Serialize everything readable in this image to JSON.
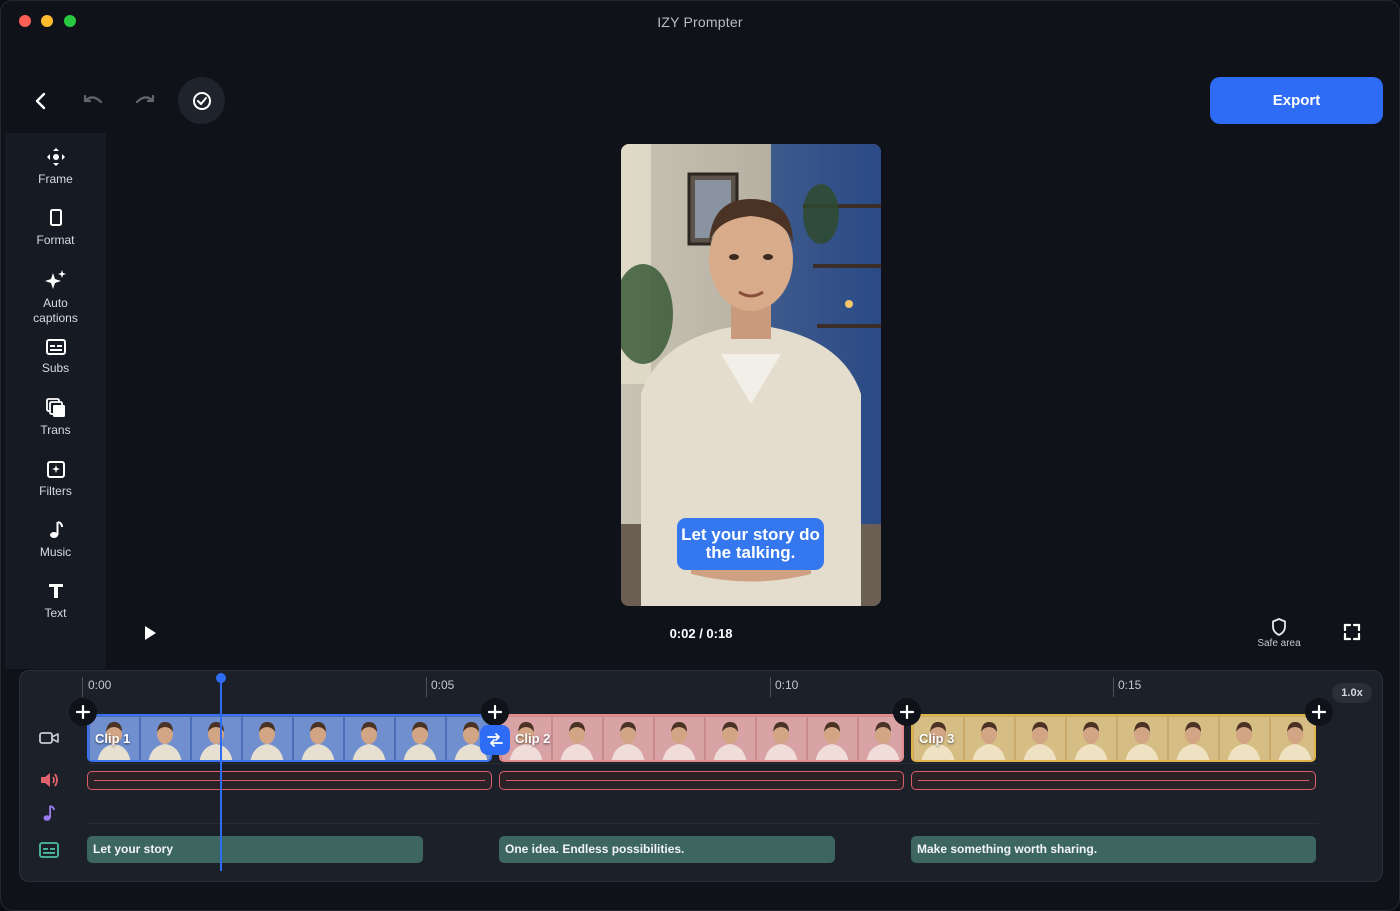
{
  "app": {
    "title": "IZY Prompter"
  },
  "toolbar": {
    "export_label": "Export"
  },
  "sidebar": {
    "items": [
      {
        "label": "Frame",
        "icon": "move-icon"
      },
      {
        "label": "Format",
        "icon": "rectangle-icon"
      },
      {
        "label": "Auto captions",
        "icon": "sparkles-icon"
      },
      {
        "label": "Subs",
        "icon": "subtitles-icon"
      },
      {
        "label": "Trans",
        "icon": "layers-icon"
      },
      {
        "label": "Filters",
        "icon": "filter-icon"
      },
      {
        "label": "Music",
        "icon": "music-note-icon"
      },
      {
        "label": "Text",
        "icon": "text-icon"
      }
    ]
  },
  "preview": {
    "caption": "Let your story do the talking.",
    "time": "0:02 / 0:18",
    "safe_area_label": "Safe area"
  },
  "timeline": {
    "ruler": [
      "0:00",
      "0:05",
      "0:10",
      "0:15"
    ],
    "speed": "1.0x",
    "clips": [
      {
        "label": "Clip 1",
        "color": "#3a72f0"
      },
      {
        "label": "Clip 2",
        "color": "#e58a8f"
      },
      {
        "label": "Clip 3",
        "color": "#e0b24a"
      }
    ],
    "subtitles": [
      "Let your story",
      "One idea. Endless possibilities.",
      "Make something worth sharing."
    ]
  },
  "colors": {
    "accent": "#2f6cf6",
    "audio": "#d85e67",
    "subtitle_chip": "#3d6660"
  }
}
